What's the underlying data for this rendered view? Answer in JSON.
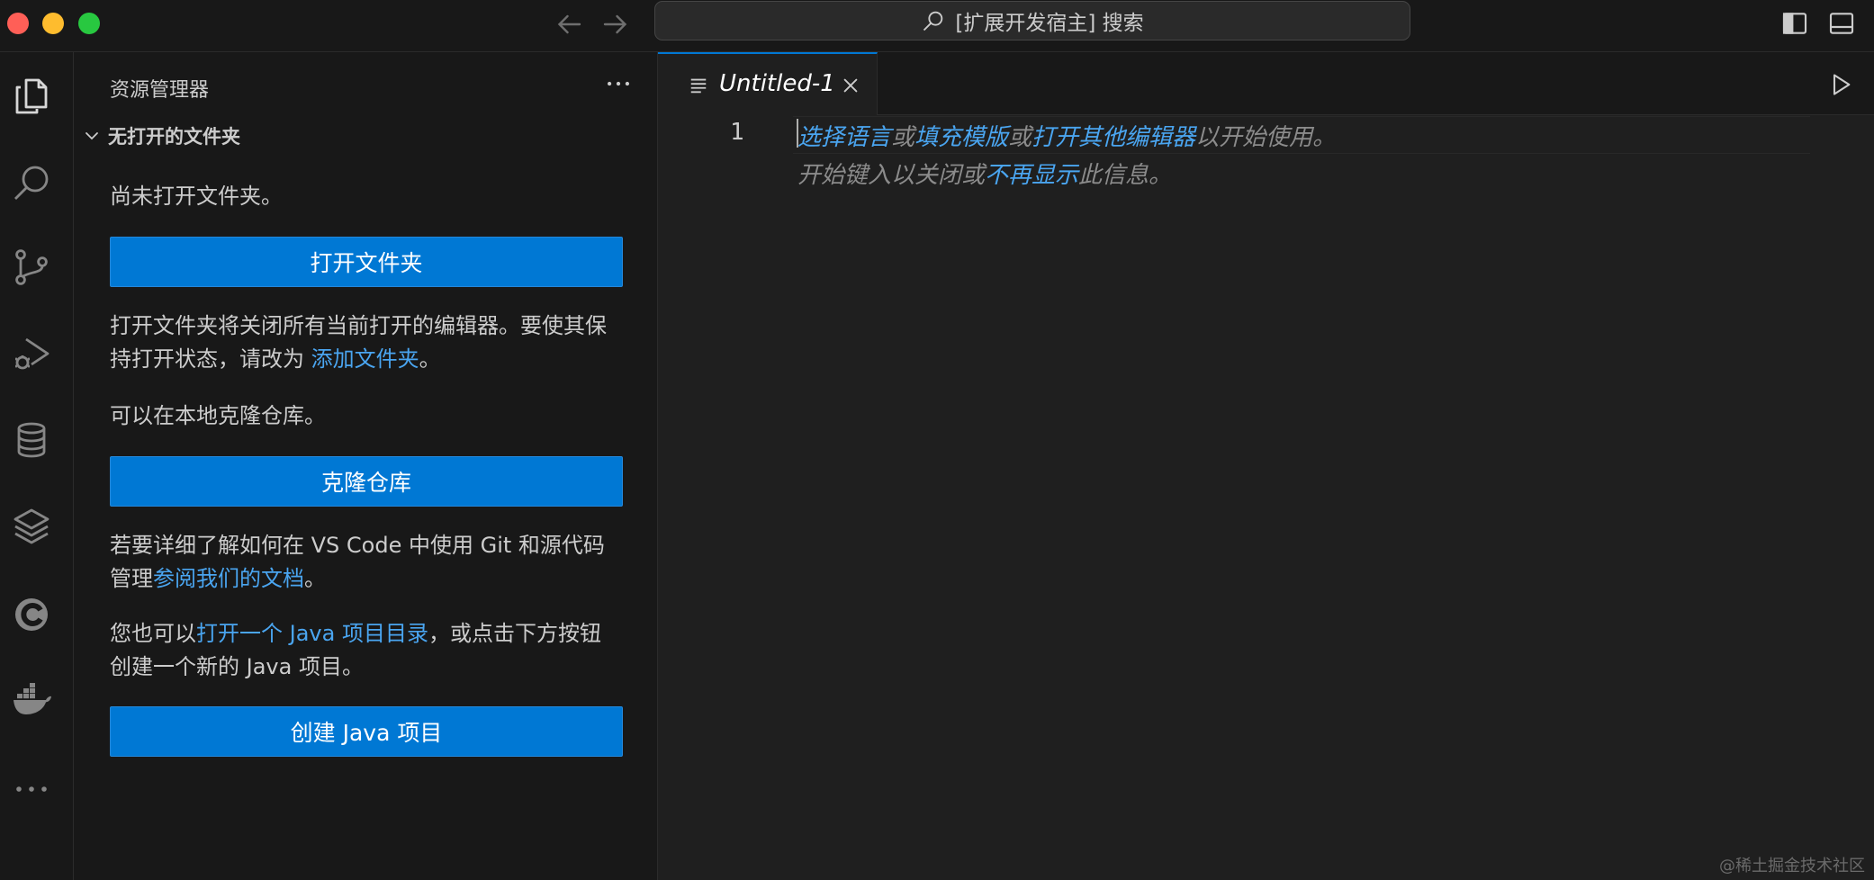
{
  "titlebar": {
    "search_text": "[扩展开发宿主] 搜索"
  },
  "activity_bar": {
    "items": [
      {
        "name": "explorer-icon",
        "active": true
      },
      {
        "name": "search-icon"
      },
      {
        "name": "source-control-icon"
      },
      {
        "name": "run-debug-icon"
      },
      {
        "name": "database-icon"
      },
      {
        "name": "layers-icon"
      },
      {
        "name": "codeium-icon"
      },
      {
        "name": "docker-icon"
      },
      {
        "name": "more-icon"
      }
    ]
  },
  "sidebar": {
    "title": "资源管理器",
    "section_title": "无打开的文件夹",
    "no_folder_text": "尚未打开文件夹。",
    "open_folder_button": "打开文件夹",
    "warning_text": "打开文件夹将关闭所有当前打开的编辑器。要使其保持打开状态，请改为 ",
    "add_folder_link": "添加文件夹",
    "warning_end": "。",
    "clone_text": "可以在本地克隆仓库。",
    "clone_button": "克隆仓库",
    "git_text": "若要详细了解如何在 VS Code 中使用 Git 和源代码管理",
    "docs_link": "参阅我们的文档",
    "git_end": "。",
    "java_text_1": "您也可以",
    "java_link": "打开一个 Java 项目目录",
    "java_text_2": "，或点击下方按钮创建一个新的 Java 项目。",
    "create_java_button": "创建 Java 项目"
  },
  "editor": {
    "tab_label": "Untitled-1",
    "line_number": "1",
    "hint1": {
      "link1": "选择语言",
      "or1": "或",
      "link2": "填充模版",
      "or2": "或",
      "link3": "打开其他编辑器",
      "suffix": "以开始使用。"
    },
    "hint2": {
      "prefix": "开始键入以关闭或",
      "link": "不再显示",
      "suffix": "此信息。"
    }
  },
  "watermark": "@稀土掘金技术社区",
  "colors": {
    "accent": "#0078d4",
    "link": "#4aa5f0",
    "background": "#1f1f1f",
    "sidebar": "#181818"
  }
}
